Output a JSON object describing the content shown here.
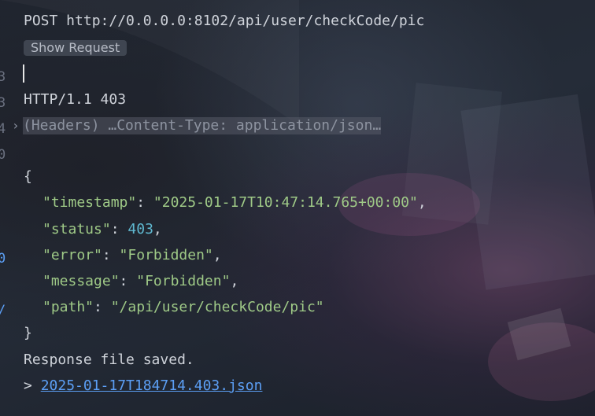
{
  "request": {
    "line": "POST http://0.0.0.0:8102/api/user/checkCode/pic",
    "show_request_label": "Show Request"
  },
  "gutter": {
    "numbers": [
      "3",
      "3",
      "4",
      "0",
      "0",
      "/"
    ]
  },
  "response": {
    "status_line": "HTTP/1.1 403",
    "headers_fold": "(Headers) …Content-Type: application/json…",
    "open_brace": "{",
    "close_brace": "}",
    "fields": {
      "timestamp_key": "\"timestamp\"",
      "timestamp_value": "\"2025-01-17T10:47:14.765+00:00\"",
      "status_key": "\"status\"",
      "status_value": "403",
      "error_key": "\"error\"",
      "error_value": "\"Forbidden\"",
      "message_key": "\"message\"",
      "message_value": "\"Forbidden\"",
      "path_key": "\"path\"",
      "path_value": "\"/api/user/checkCode/pic\""
    },
    "saved_text": "Response file saved.",
    "file_prefix": "> ",
    "file_link": "2025-01-17T184714.403.json"
  },
  "icons": {
    "fold": "chevron-right-icon"
  },
  "colors": {
    "json_string": "#9fca87",
    "json_number": "#5fb8d0",
    "link": "#5c9ff5"
  }
}
